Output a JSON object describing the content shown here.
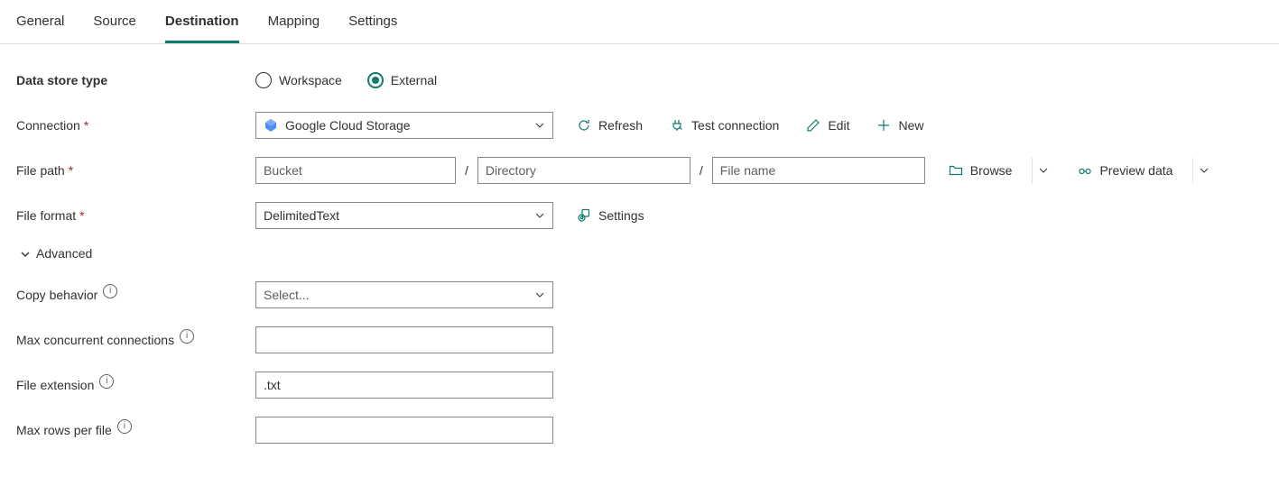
{
  "tabs": {
    "items": [
      {
        "label": "General"
      },
      {
        "label": "Source"
      },
      {
        "label": "Destination"
      },
      {
        "label": "Mapping"
      },
      {
        "label": "Settings"
      }
    ],
    "activeIndex": 2
  },
  "labels": {
    "data_store_type": "Data store type",
    "connection": "Connection",
    "file_path": "File path",
    "file_format": "File format",
    "advanced": "Advanced",
    "copy_behavior": "Copy behavior",
    "max_concurrent": "Max concurrent connections",
    "file_extension": "File extension",
    "max_rows": "Max rows per file"
  },
  "radio": {
    "workspace": "Workspace",
    "external": "External",
    "selected": "external"
  },
  "connection": {
    "value": "Google Cloud Storage"
  },
  "actions": {
    "refresh": "Refresh",
    "test_connection": "Test connection",
    "edit": "Edit",
    "new": "New",
    "browse": "Browse",
    "preview_data": "Preview data",
    "settings": "Settings"
  },
  "file_path": {
    "bucket_placeholder": "Bucket",
    "directory_placeholder": "Directory",
    "filename_placeholder": "File name"
  },
  "file_format": {
    "value": "DelimitedText"
  },
  "copy_behavior": {
    "placeholder": "Select..."
  },
  "max_concurrent": {
    "value": ""
  },
  "file_extension": {
    "value": ".txt"
  },
  "max_rows": {
    "value": ""
  }
}
